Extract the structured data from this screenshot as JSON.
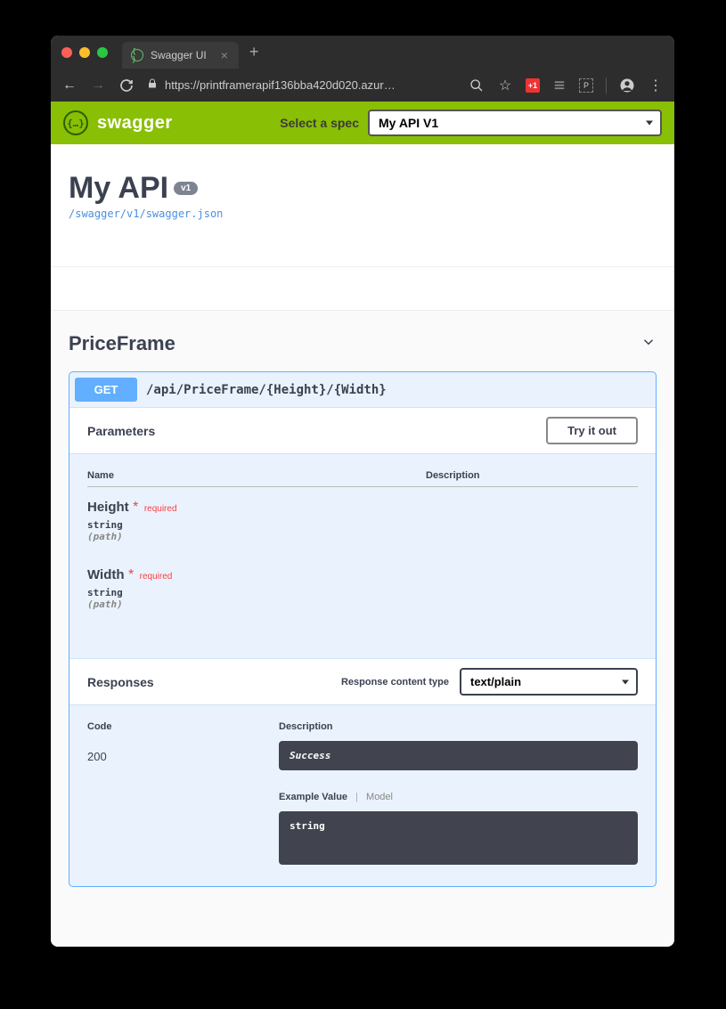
{
  "browser": {
    "tab_title": "Swagger UI",
    "url": "https://printframerapif136bba420d020.azur…"
  },
  "swagger": {
    "brand": "swagger",
    "spec_label": "Select a spec",
    "spec_selected": "My API V1"
  },
  "info": {
    "title": "My API",
    "version_badge": "v1",
    "json_path": "/swagger/v1/swagger.json"
  },
  "tag": {
    "name": "PriceFrame"
  },
  "endpoint": {
    "method": "GET",
    "path": "/api/PriceFrame/{Height}/{Width}",
    "params_title": "Parameters",
    "tryit_label": "Try it out",
    "col_name": "Name",
    "col_desc": "Description",
    "params": [
      {
        "name": "Height",
        "required": "required",
        "type": "string",
        "in": "(path)"
      },
      {
        "name": "Width",
        "required": "required",
        "type": "string",
        "in": "(path)"
      }
    ],
    "responses_title": "Responses",
    "content_type_label": "Response content type",
    "content_type_value": "text/plain",
    "rcol_code": "Code",
    "rcol_desc": "Description",
    "response_code": "200",
    "response_desc": "Success",
    "example_tab_active": "Example Value",
    "example_tab_inactive": "Model",
    "example_body": "string"
  }
}
